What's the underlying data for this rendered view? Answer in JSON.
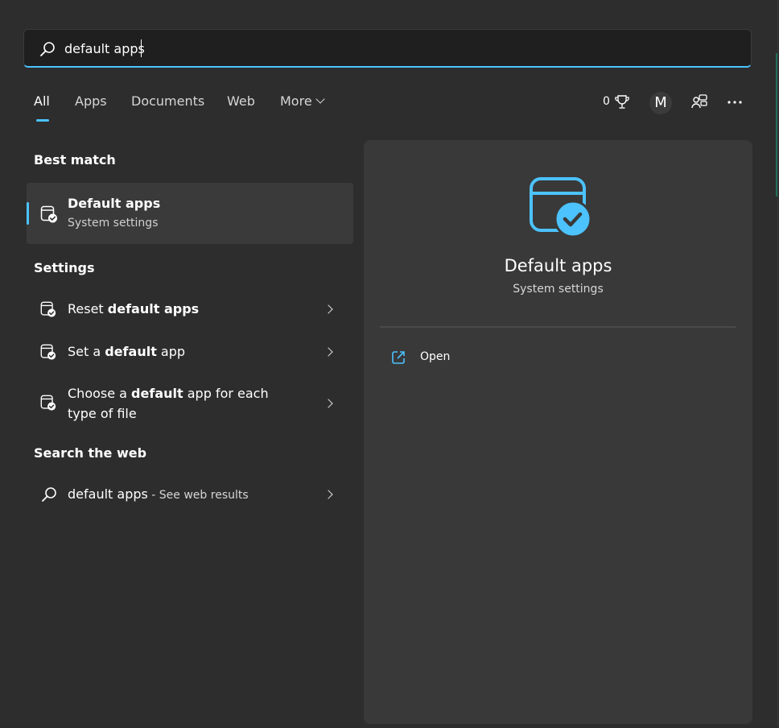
{
  "search": {
    "value": "default apps",
    "icon": "search-icon"
  },
  "tabs": [
    {
      "label": "All",
      "active": true
    },
    {
      "label": "Apps"
    },
    {
      "label": "Documents"
    },
    {
      "label": "Web"
    },
    {
      "label": "More"
    }
  ],
  "header": {
    "points": "0",
    "points_icon": "trophy-icon",
    "avatar_initial": "M",
    "share_icon": "people-switch-icon",
    "more_icon": "ellipsis-icon"
  },
  "best_match": {
    "section_title": "Best match",
    "title": "Default apps",
    "subtitle": "System settings",
    "icon": "default-apps-icon"
  },
  "settings": {
    "section_title": "Settings",
    "items": [
      {
        "prefix": "Reset ",
        "bold": "default apps",
        "suffix": "",
        "icon": "default-apps-icon"
      },
      {
        "prefix": "Set a ",
        "bold": "default",
        "suffix": " app",
        "icon": "default-apps-icon"
      },
      {
        "prefix": "Choose a ",
        "bold": "default",
        "suffix": " app for each",
        "line2": "type of file",
        "icon": "default-apps-icon"
      }
    ]
  },
  "web": {
    "section_title": "Search the web",
    "query": "default apps",
    "suffix": " - See web results",
    "icon": "search-icon"
  },
  "preview": {
    "title": "Default apps",
    "subtitle": "System settings",
    "open_label": "Open",
    "open_icon": "open-external-icon"
  },
  "colors": {
    "accent": "#4cc2ff",
    "panel": "#2d2d2d",
    "preview": "#393939"
  }
}
